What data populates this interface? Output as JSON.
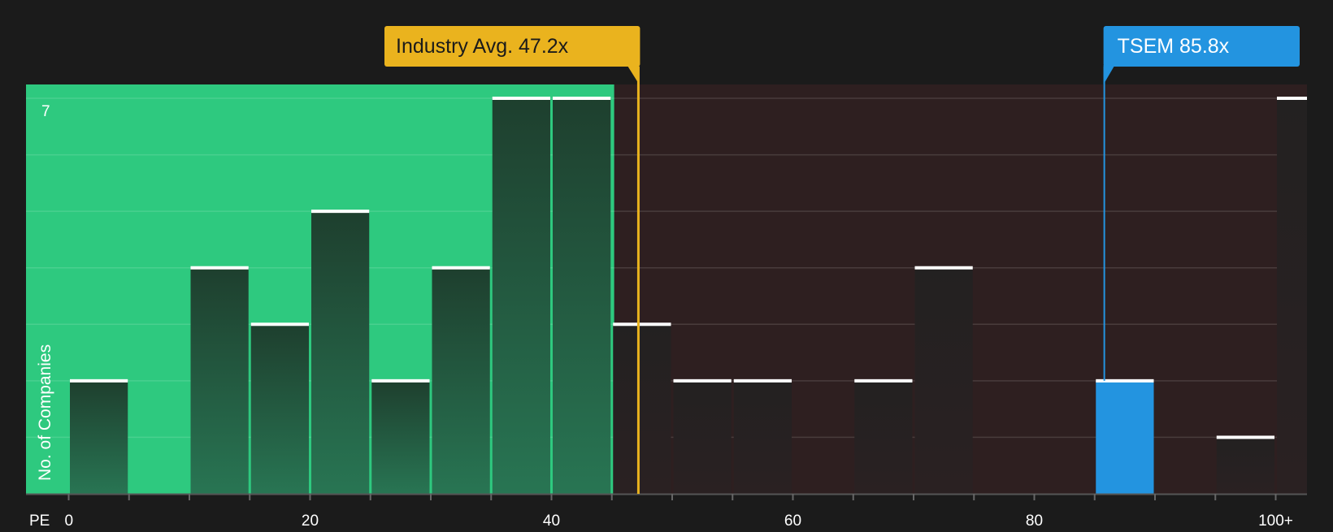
{
  "colors": {
    "background": "#1b1b1b",
    "below_region": "#2ec97f",
    "above_region": "#2e1f20",
    "bar_fill": "#212121",
    "bar_top": "#ffffff",
    "industry_avg": "#eab31e",
    "highlight": "#2394e0",
    "axis_text": "#ffffff"
  },
  "chart_data": {
    "type": "bar",
    "x_axis_label": "PE",
    "y_axis_label": "No. of Companies",
    "xlim": [
      -6,
      103
    ],
    "ylim": [
      0,
      7.25
    ],
    "x_ticks": [
      {
        "value": 0,
        "label": "0"
      },
      {
        "value": 20,
        "label": "20"
      },
      {
        "value": 40,
        "label": "40"
      },
      {
        "value": 60,
        "label": "60"
      },
      {
        "value": 80,
        "label": "80"
      },
      {
        "value": 100,
        "label": "100+"
      }
    ],
    "y_ticks": [
      {
        "value": 7,
        "label": "7"
      }
    ],
    "grid": true,
    "bin_width": 5,
    "bins": [
      {
        "start": 0,
        "count": 2
      },
      {
        "start": 5,
        "count": 0
      },
      {
        "start": 10,
        "count": 4
      },
      {
        "start": 15,
        "count": 3
      },
      {
        "start": 20,
        "count": 5
      },
      {
        "start": 25,
        "count": 2
      },
      {
        "start": 30,
        "count": 4
      },
      {
        "start": 35,
        "count": 7
      },
      {
        "start": 40,
        "count": 7
      },
      {
        "start": 45,
        "count": 3
      },
      {
        "start": 50,
        "count": 2
      },
      {
        "start": 55,
        "count": 2
      },
      {
        "start": 60,
        "count": 0
      },
      {
        "start": 65,
        "count": 2
      },
      {
        "start": 70,
        "count": 4
      },
      {
        "start": 75,
        "count": 0
      },
      {
        "start": 80,
        "count": 0
      },
      {
        "start": 85,
        "count": 2,
        "highlight": true
      },
      {
        "start": 90,
        "count": 0
      },
      {
        "start": 95,
        "count": 1
      },
      {
        "start": 100,
        "count": 7
      }
    ],
    "industry_avg": {
      "value": 47.2,
      "label": "Industry Avg. 47.2x"
    },
    "company": {
      "value": 85.8,
      "label": "TSEM 85.8x"
    }
  }
}
